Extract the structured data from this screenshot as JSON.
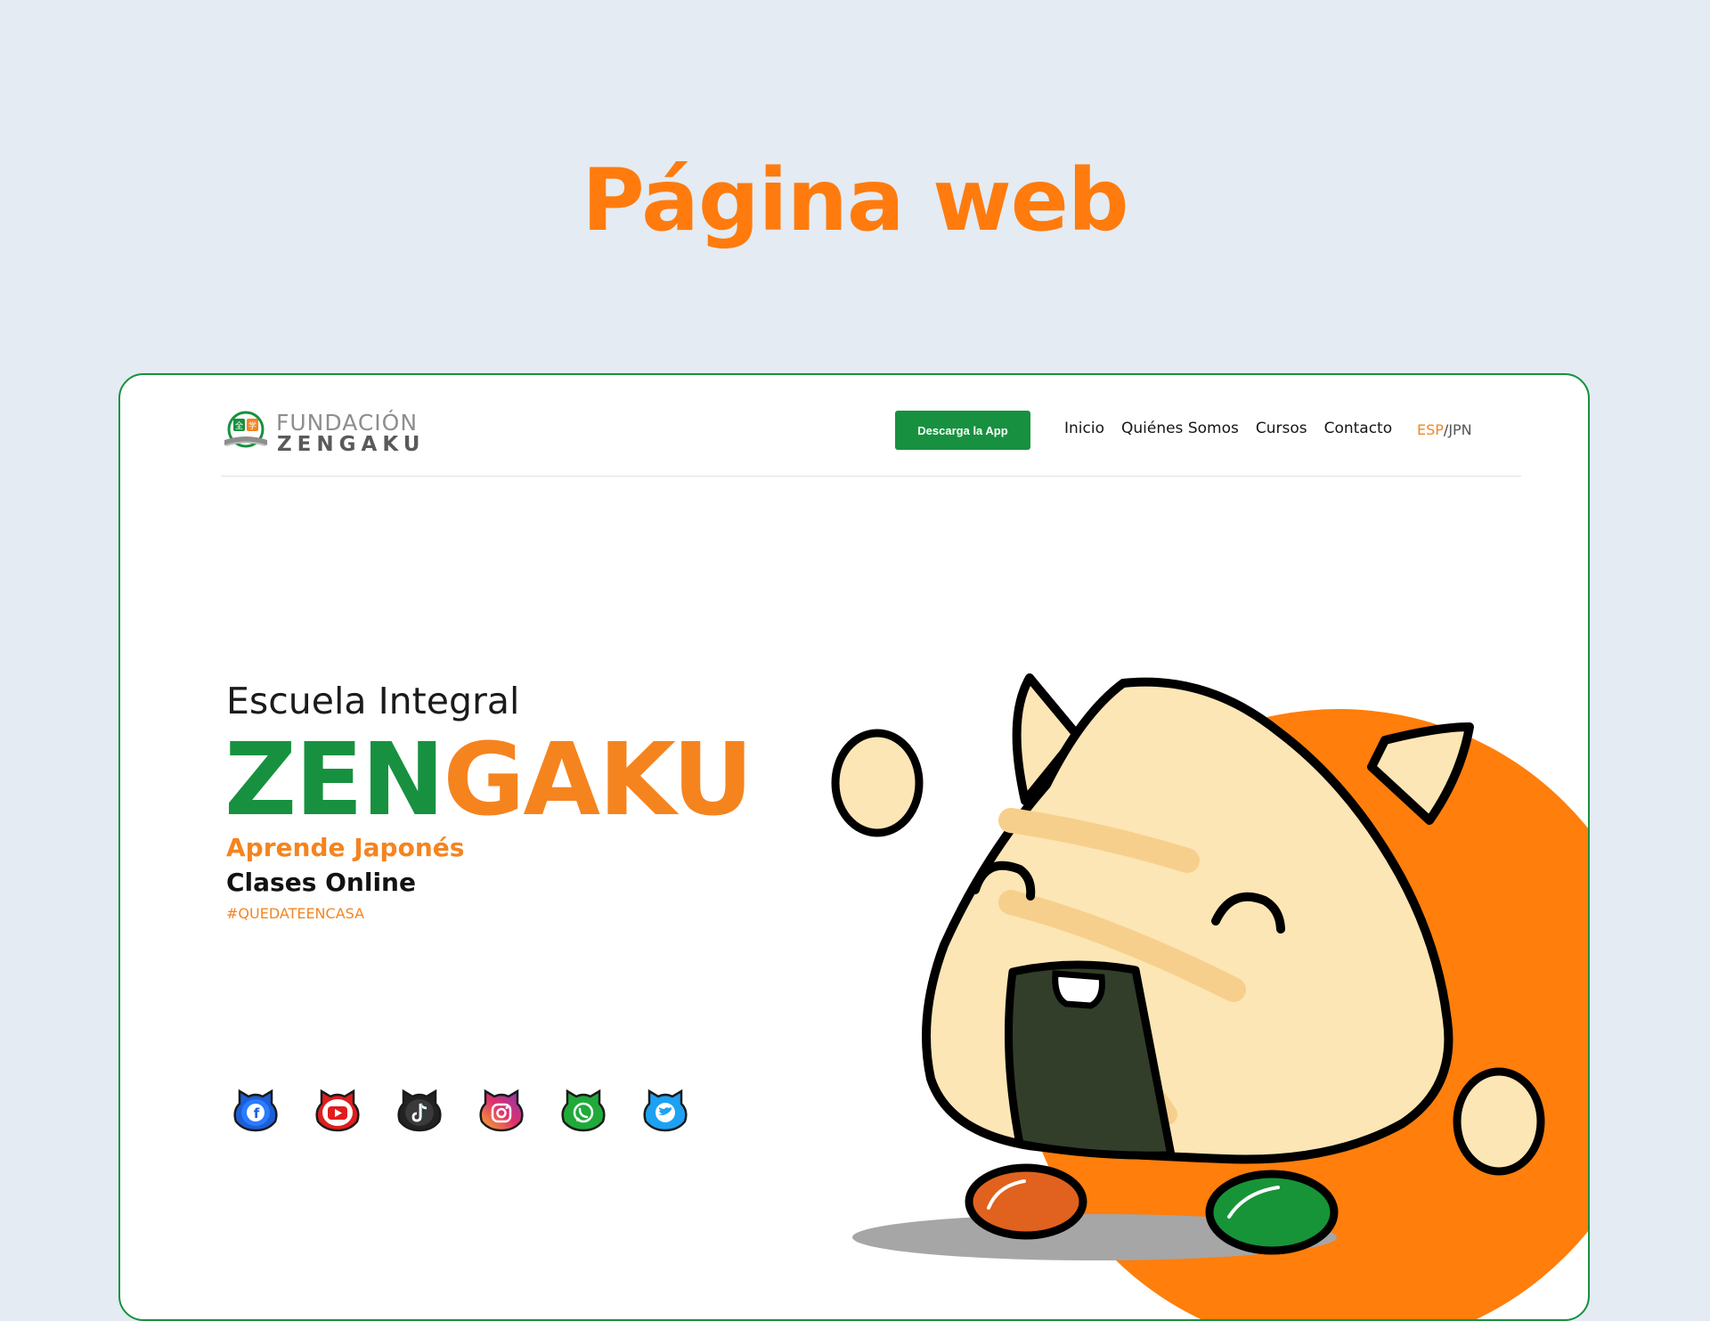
{
  "page_title": "Página web",
  "logo": {
    "line1": "FUNDACIÓN",
    "line2": "ZENGAKU"
  },
  "header": {
    "download_button": "Descarga la App",
    "nav": [
      "Inicio",
      "Quiénes Somos",
      "Cursos",
      "Contacto"
    ],
    "lang": {
      "esp": "ESP",
      "separator": "/",
      "jpn": "JPN"
    }
  },
  "hero": {
    "subtitle": "Escuela Integral",
    "title_part1": "ZEN",
    "title_part2": "GAKU",
    "tagline1": "Aprende Japonés",
    "tagline2": "Clases Online",
    "hashtag": "#QUEDATEENCASA"
  },
  "social": [
    {
      "name": "facebook-icon",
      "color": "#1b5fd8"
    },
    {
      "name": "youtube-icon",
      "color": "#e11d1d"
    },
    {
      "name": "tiktok-icon",
      "color": "#222222"
    },
    {
      "name": "instagram-icon",
      "color": "#d6308c"
    },
    {
      "name": "whatsapp-icon",
      "color": "#1faa3a"
    },
    {
      "name": "twitter-icon",
      "color": "#1da1f2"
    }
  ],
  "colors": {
    "accent_orange": "#f5841f",
    "title_orange": "#ff7b0e",
    "brand_green": "#17913f",
    "background": "#e4ebf2"
  }
}
